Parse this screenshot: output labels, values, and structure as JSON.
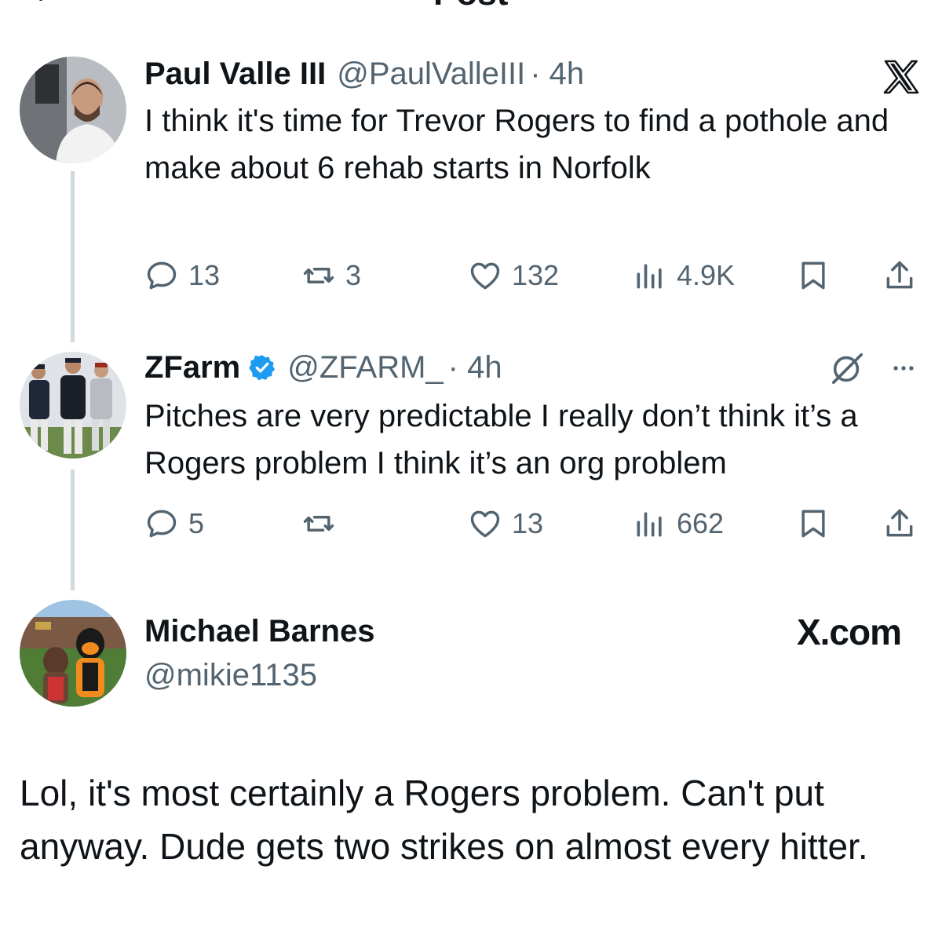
{
  "header": {
    "title": "Post"
  },
  "tweets": [
    {
      "display_name": "Paul Valle III",
      "handle": "@PaulValleIII",
      "time": "· 4h",
      "text": "I think it's time for Trevor Rogers to find a pothole and make about 6 rehab starts in Norfolk",
      "replies": "13",
      "reposts": "3",
      "likes": "132",
      "views": "4.9K"
    },
    {
      "display_name": "ZFarm",
      "handle": "@ZFARM_",
      "time": "· 4h",
      "text": "Pitches are very predictable I really don’t think it’s a Rogers problem I think it’s an org problem",
      "replies": "5",
      "reposts": "",
      "likes": "13",
      "views": "662"
    }
  ],
  "reply": {
    "display_name": "Michael Barnes",
    "handle": "@mikie1135",
    "brand": "X.com",
    "text": "Lol, it's most certainly a Rogers problem. Can't put anyway. Dude gets two strikes on almost every hitter."
  },
  "icons": {
    "back": "back-arrow-icon",
    "x_logo": "x-logo-icon",
    "reply": "reply-icon",
    "repost": "repost-icon",
    "like": "heart-icon",
    "views": "views-icon",
    "bookmark": "bookmark-icon",
    "share": "share-icon",
    "grok": "grok-icon",
    "more": "more-icon",
    "verified": "verified-badge-icon"
  },
  "colors": {
    "text": "#0f1419",
    "secondary": "#536471",
    "verified": "#1d9bf0",
    "thread_line": "#cfd9de"
  }
}
